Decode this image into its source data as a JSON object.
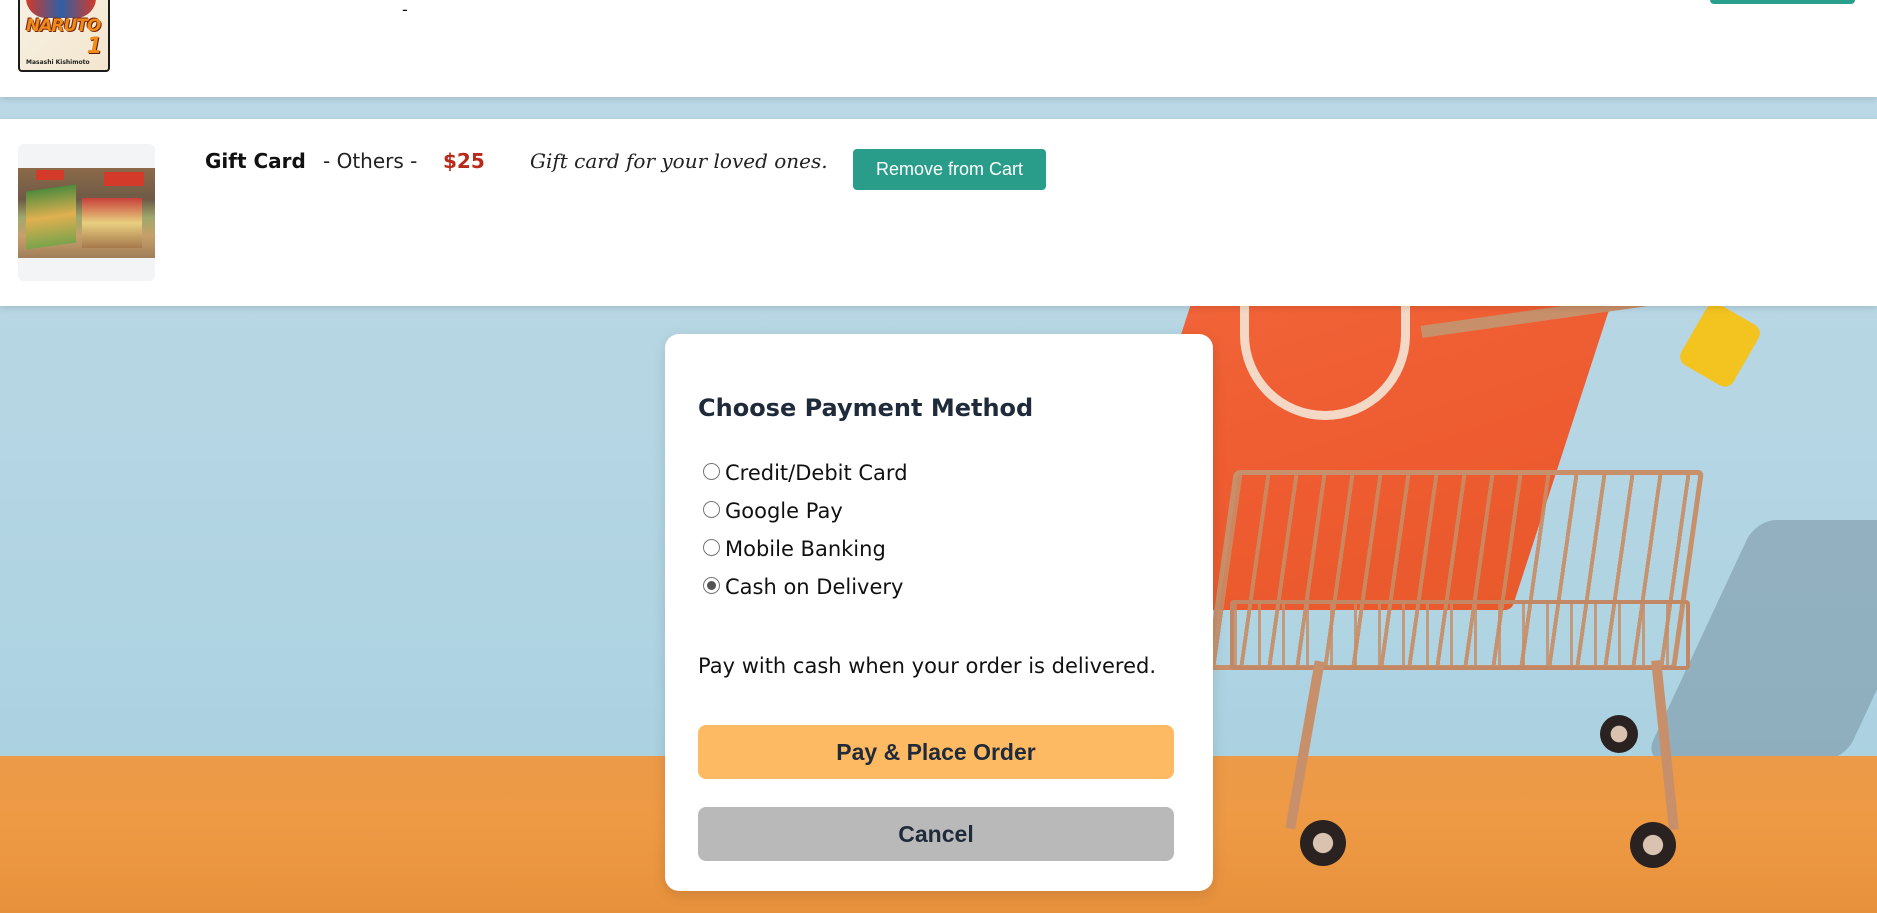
{
  "top_item": {
    "separator": "-"
  },
  "cart_item": {
    "name": "Gift Card",
    "category": "- Others -",
    "price": "$25",
    "description": "Gift card for your loved ones.",
    "remove_label": "Remove from Cart"
  },
  "payment": {
    "title": "Choose Payment Method",
    "options": [
      {
        "label": "Credit/Debit Card",
        "selected": false
      },
      {
        "label": "Google Pay",
        "selected": false
      },
      {
        "label": "Mobile Banking",
        "selected": false
      },
      {
        "label": "Cash on Delivery",
        "selected": true
      }
    ],
    "note": "Pay with cash when your order is delivered.",
    "place_order_label": "Pay & Place Order",
    "cancel_label": "Cancel"
  },
  "colors": {
    "accent_teal": "#2a9d8a",
    "price_red": "#b82a1a",
    "place_order_bg": "#fdba63",
    "cancel_bg": "#b9b9b9"
  }
}
